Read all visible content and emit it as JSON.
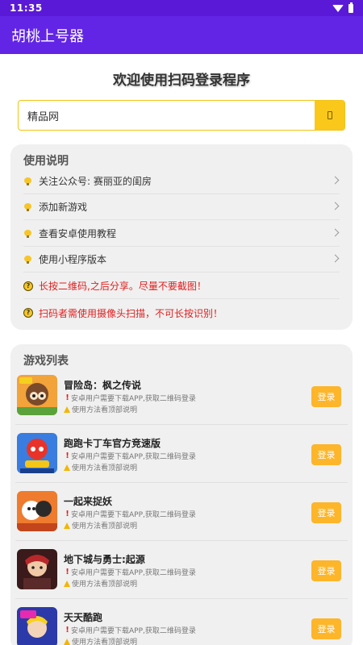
{
  "status_bar": {
    "time": "11:35",
    "wifi_icon": "wifi-icon",
    "battery_icon": "battery-icon"
  },
  "app_bar": {
    "title": "胡桃上号器",
    "color": "#6225e6"
  },
  "heading": "欢迎使用扫码登录程序",
  "search": {
    "value": "精品网",
    "button_icon": "search-icon",
    "accent": "#f9c81a"
  },
  "instructions": {
    "title": "使用说明",
    "items": [
      {
        "label": "关注公众号: 赛丽亚的闺房",
        "icon": "bulb-icon"
      },
      {
        "label": "添加新游戏",
        "icon": "bulb-icon"
      },
      {
        "label": "查看安卓使用教程",
        "icon": "bulb-icon"
      },
      {
        "label": "使用小程序版本",
        "icon": "bulb-icon"
      }
    ],
    "notices": [
      {
        "text": "长按二维码,之后分享。尽量不要截图！",
        "icon": "warning-face-icon",
        "color": "#e02020"
      },
      {
        "text": "扫码者需使用摄像头扫描，不可长按识别！",
        "icon": "warning-face-icon",
        "color": "#e02020"
      }
    ]
  },
  "games": {
    "title": "游戏列表",
    "note_android": "安卓用户需要下载APP,获取二维码登录",
    "note_usage": "使用方法看顶部说明",
    "login_label": "登录",
    "items": [
      {
        "name": "冒险岛：枫之传说"
      },
      {
        "name": "跑跑卡丁车官方竞速版"
      },
      {
        "name": "一起来捉妖"
      },
      {
        "name": "地下城与勇士:起源"
      },
      {
        "name": "天天酷跑"
      }
    ]
  }
}
